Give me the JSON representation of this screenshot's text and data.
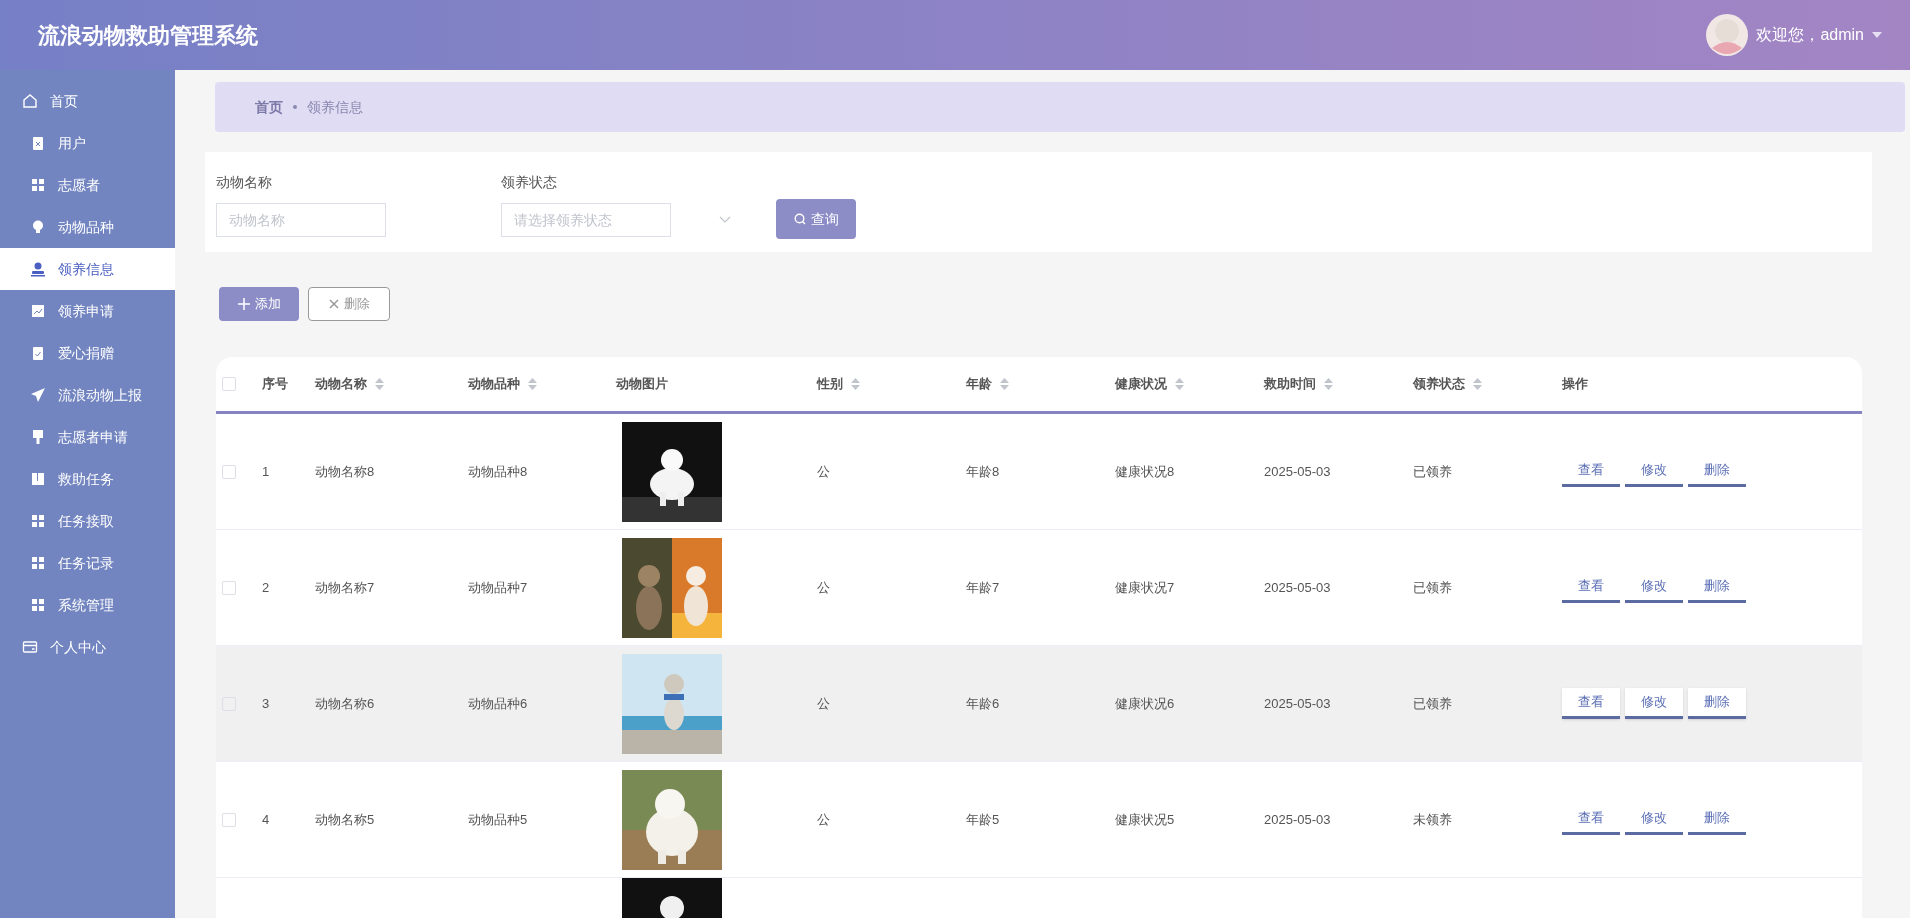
{
  "header": {
    "title": "流浪动物救助管理系统",
    "welcome": "欢迎您，admin"
  },
  "sidebar": {
    "items": [
      {
        "label": "首页",
        "kind": "top",
        "selected": false
      },
      {
        "label": "用户",
        "kind": "module",
        "selected": false
      },
      {
        "label": "志愿者",
        "kind": "module",
        "selected": false
      },
      {
        "label": "动物品种",
        "kind": "module",
        "selected": false
      },
      {
        "label": "领养信息",
        "kind": "module",
        "selected": true
      },
      {
        "label": "领养申请",
        "kind": "module",
        "selected": false
      },
      {
        "label": "爱心捐赠",
        "kind": "module",
        "selected": false
      },
      {
        "label": "流浪动物上报",
        "kind": "module",
        "selected": false
      },
      {
        "label": "志愿者申请",
        "kind": "module",
        "selected": false
      },
      {
        "label": "救助任务",
        "kind": "module",
        "selected": false
      },
      {
        "label": "任务接取",
        "kind": "module",
        "selected": false
      },
      {
        "label": "任务记录",
        "kind": "module",
        "selected": false
      },
      {
        "label": "系统管理",
        "kind": "module",
        "selected": false
      },
      {
        "label": "个人中心",
        "kind": "top",
        "selected": false
      }
    ]
  },
  "breadcrumb": [
    "首页",
    "领养信息"
  ],
  "filters": [
    {
      "label": "动物名称",
      "kind": "input",
      "placeholder": "动物名称"
    },
    {
      "label": "领养状态",
      "kind": "select",
      "placeholder": "请选择领养状态"
    }
  ],
  "search_button": "查询",
  "actions": {
    "add": "添加",
    "delete": "删除"
  },
  "table": {
    "select_all_checked": false,
    "columns": [
      {
        "label": "序号",
        "sortable": false
      },
      {
        "label": "动物名称",
        "sortable": true
      },
      {
        "label": "动物品种",
        "sortable": true
      },
      {
        "label": "动物图片",
        "sortable": false
      },
      {
        "label": "性别",
        "sortable": true
      },
      {
        "label": "年龄",
        "sortable": true
      },
      {
        "label": "健康状况",
        "sortable": true
      },
      {
        "label": "救助时间",
        "sortable": true
      },
      {
        "label": "领养状态",
        "sortable": true
      },
      {
        "label": "操作",
        "sortable": false
      }
    ],
    "rows": [
      {
        "index": "1",
        "name": "动物名称8",
        "breed": "动物品种8",
        "sex": "公",
        "age": "年龄8",
        "health": "健康状况8",
        "date": "2025-05-03",
        "status": "已领养",
        "hovered": false,
        "checked": false,
        "actions": [
          "查看",
          "修改",
          "删除"
        ]
      },
      {
        "index": "2",
        "name": "动物名称7",
        "breed": "动物品种7",
        "sex": "公",
        "age": "年龄7",
        "health": "健康状况7",
        "date": "2025-05-03",
        "status": "已领养",
        "hovered": false,
        "checked": false,
        "actions": [
          "查看",
          "修改",
          "删除"
        ]
      },
      {
        "index": "3",
        "name": "动物名称6",
        "breed": "动物品种6",
        "sex": "公",
        "age": "年龄6",
        "health": "健康状况6",
        "date": "2025-05-03",
        "status": "已领养",
        "hovered": true,
        "checked": false,
        "actions": [
          "查看",
          "修改",
          "删除"
        ]
      },
      {
        "index": "4",
        "name": "动物名称5",
        "breed": "动物品种5",
        "sex": "公",
        "age": "年龄5",
        "health": "健康状况5",
        "date": "2025-05-03",
        "status": "未领养",
        "hovered": false,
        "checked": false,
        "actions": [
          "查看",
          "修改",
          "删除"
        ]
      }
    ]
  }
}
